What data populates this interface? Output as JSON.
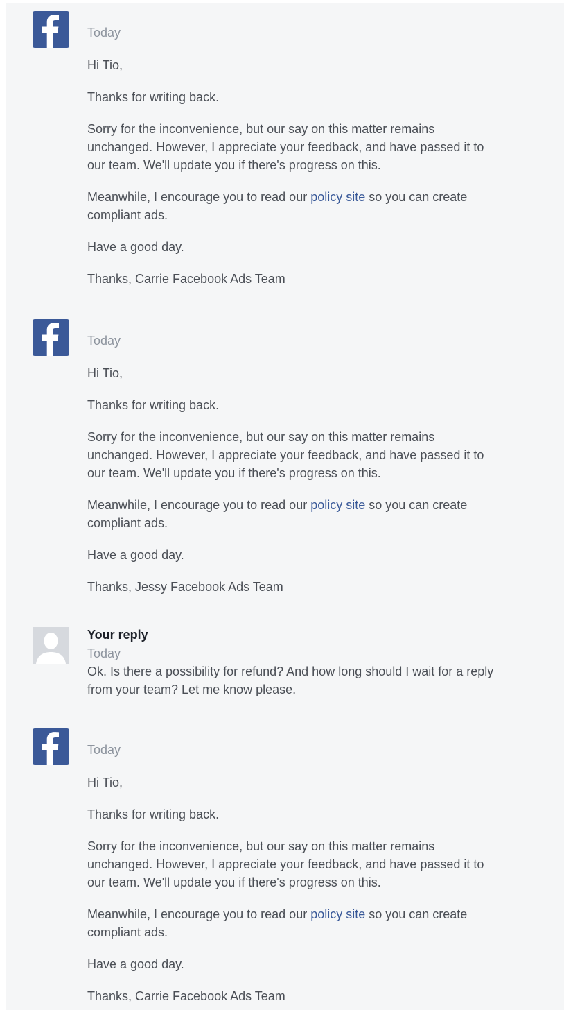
{
  "messages": [
    {
      "sender": "facebook",
      "avatar_icon": "facebook-logo-icon",
      "date": "Today",
      "greeting": "Hi Tio,",
      "p1": "Thanks for writing back.",
      "p2_lines": [
        "Sorry for the inconvenience, but our say on this matter remains",
        "unchanged. However, I appreciate your feedback, and have passed it to",
        "our team. We'll update you if there's progress on this."
      ],
      "p3_before": "Meanwhile, I encourage you to read our ",
      "p3_link": "policy site",
      "p3_after": " so you can create",
      "p3_line2": "compliant ads.",
      "p4": "Have a good day.",
      "signoff": "Thanks, Carrie Facebook Ads Team"
    },
    {
      "sender": "facebook",
      "avatar_icon": "facebook-logo-icon",
      "date": "Today",
      "greeting": "Hi Tio,",
      "p1": "Thanks for writing back.",
      "p2_lines": [
        "Sorry for the inconvenience, but our say on this matter remains",
        "unchanged. However, I appreciate your feedback, and have passed it to",
        "our team. We'll update you if there's progress on this."
      ],
      "p3_before": "Meanwhile, I encourage you to read our ",
      "p3_link": "policy site",
      "p3_after": " so you can create",
      "p3_line2": "compliant ads.",
      "p4": "Have a good day.",
      "signoff": "Thanks, Jessy Facebook Ads Team"
    },
    {
      "sender": "user",
      "avatar_icon": "default-user-avatar-icon",
      "title": "Your reply",
      "date": "Today",
      "text_lines": [
        "Ok. Is there a possibility for refund? And how long should I wait for a reply",
        "from your team? Let me know please."
      ]
    },
    {
      "sender": "facebook",
      "avatar_icon": "facebook-logo-icon",
      "date": "Today",
      "greeting": "Hi Tio,",
      "p1": "Thanks for writing back.",
      "p2_lines": [
        "Sorry for the inconvenience, but our say on this matter remains",
        "unchanged. However, I appreciate your feedback, and have passed it to",
        "our team. We'll update you if there's progress on this."
      ],
      "p3_before": "Meanwhile, I encourage you to read our ",
      "p3_link": "policy site",
      "p3_after": " so you can create",
      "p3_line2": "compliant ads.",
      "p4": "Have a good day.",
      "signoff": "Thanks, Carrie Facebook Ads Team"
    }
  ],
  "colors": {
    "facebook_blue": "#3b5998",
    "link": "#385898",
    "background": "#f5f6f7",
    "text": "#4b4f56",
    "muted": "#8d949e"
  }
}
